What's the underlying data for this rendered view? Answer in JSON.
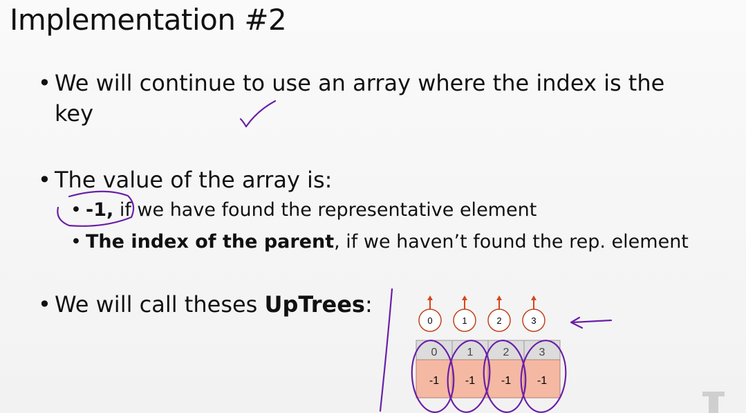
{
  "slide": {
    "title": "Implementation #2",
    "bullet_char": "•",
    "bullet1": {
      "line1": "We will continue to use an array where the index is the",
      "line2": "key"
    },
    "bullet2": {
      "text": "The value of the array is:",
      "sub1": {
        "bold": "-1,",
        "rest": " if we have found the representative element"
      },
      "sub2": {
        "bold": "The index of the parent",
        "rest": ", if we haven’t found the rep. element"
      }
    },
    "bullet3": {
      "text": "We will call theses ",
      "bold": "UpTrees",
      "after": ":"
    }
  },
  "diagram": {
    "nodes": [
      "0",
      "1",
      "2",
      "3"
    ],
    "index_labels": [
      "0",
      "1",
      "2",
      "3"
    ],
    "values": [
      "-1",
      "-1",
      "-1",
      "-1"
    ],
    "colors": {
      "node_stroke": "#c0411a",
      "arrow": "#d6461c",
      "index_fill": "#dcdcdc",
      "value_fill": "#f5b8a3",
      "ink": "#6a1fa8"
    }
  }
}
